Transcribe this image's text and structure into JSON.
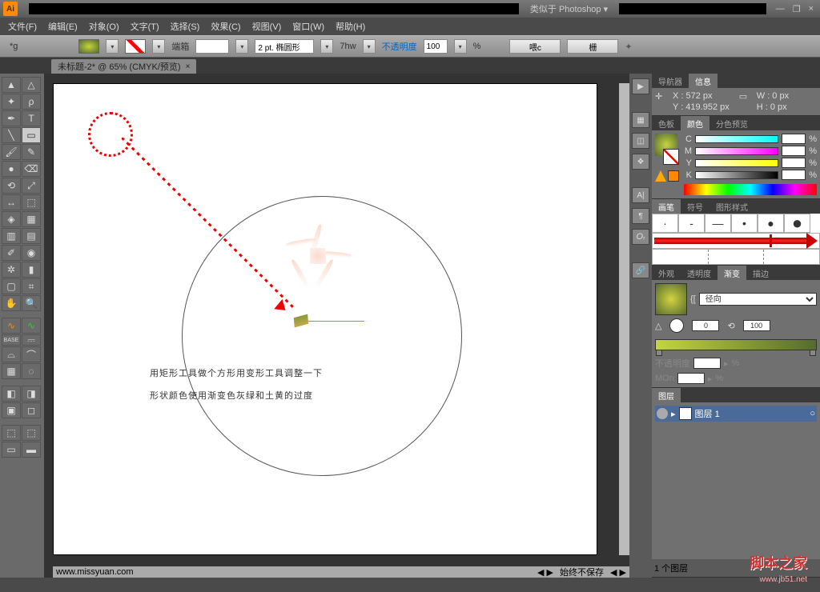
{
  "titleBar": {
    "workspace": "类似于 Photoshop",
    "logoText": "Ai"
  },
  "winControls": {
    "min": "—",
    "restore": "❐",
    "close": "×"
  },
  "menu": {
    "file": "文件(F)",
    "edit": "编辑(E)",
    "object": "对象(O)",
    "type": "文字(T)",
    "select": "选择(S)",
    "effect": "效果(C)",
    "view": "视图(V)",
    "window": "窗口(W)",
    "help": "帮助(H)"
  },
  "options": {
    "label": "*g",
    "stroke": "端箱",
    "strokeProfile": "2 pt. 椭圆形",
    "profileSuffix": "7hw",
    "opacity": "不透明度",
    "opacityVal": "100",
    "opacityUnit": "%",
    "btn1": "喂c",
    "btn2": "栅"
  },
  "docTab": {
    "name": "未标题-2* @ 65% (CMYK/预览)"
  },
  "instruction": {
    "line1": "用矩形工具做个方形用变形工具调整一下",
    "line2": "形状颜色使用渐变色灰绿和土黄的过度"
  },
  "canvasStatus": {
    "url": "www.missyuan.com",
    "save": "始终不保存"
  },
  "panels": {
    "navInfo": {
      "tab1": "导航器",
      "tab2": "信息",
      "x": "X : 572 px",
      "y": "Y : 419.952 px",
      "w": "W : 0 px",
      "h": "H : 0 px"
    },
    "color": {
      "tab1": "色板",
      "tab2": "颜色",
      "tab3": "分色预览",
      "c": "C",
      "m": "M",
      "y": "Y",
      "k": "K",
      "unit": "%"
    },
    "brush": {
      "tab1": "画笔",
      "tab2": "符号",
      "tab3": "图形样式"
    },
    "grad": {
      "tab1": "外观",
      "tab2": "透明度",
      "tab3": "渐变",
      "tab4": "描边",
      "typeLabel": "{[",
      "type": "径向",
      "angleIcon": "△",
      "angleVal": "0",
      "ratioIcon": "⟲",
      "ratioVal": "100",
      "opacityLabel": "不透明度",
      "opacityUnit": "%",
      "monLabel": "MOn",
      "monUnit": "%"
    },
    "layers": {
      "tab": "图层",
      "layer1": "图层 1",
      "count": "1 个图层",
      "targetIcon": "○"
    }
  },
  "watermark": {
    "text": "脚本之家",
    "url": "www.jb51.net"
  }
}
